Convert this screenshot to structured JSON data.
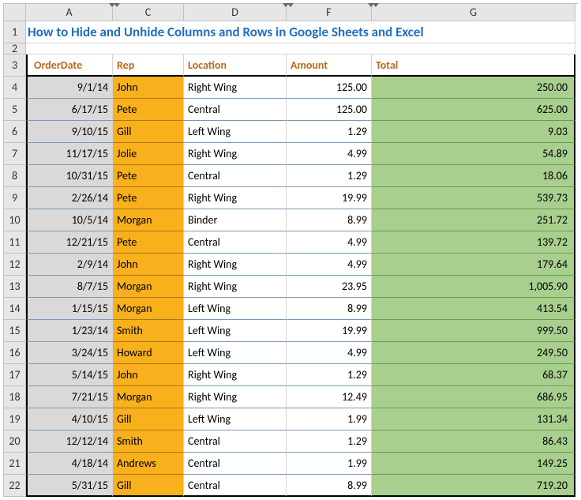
{
  "columns": [
    "A",
    "C",
    "D",
    "F",
    "G"
  ],
  "hidden_markers_after": [
    "A",
    "D",
    "F"
  ],
  "title": "How to Hide and Unhide Columns and Rows in Google Sheets and Excel",
  "headers": {
    "order_date": "OrderDate",
    "rep": "Rep",
    "location": "Location",
    "amount": "Amount",
    "total": "Total"
  },
  "rows": [
    {
      "n": 4,
      "date": "9/1/14",
      "rep": "John",
      "loc": "Right Wing",
      "amt": "125.00",
      "tot": "250.00"
    },
    {
      "n": 5,
      "date": "6/17/15",
      "rep": "Pete",
      "loc": "Central",
      "amt": "125.00",
      "tot": "625.00"
    },
    {
      "n": 6,
      "date": "9/10/15",
      "rep": "Gill",
      "loc": "Left Wing",
      "amt": "1.29",
      "tot": "9.03"
    },
    {
      "n": 7,
      "date": "11/17/15",
      "rep": "Jolie",
      "loc": "Right Wing",
      "amt": "4.99",
      "tot": "54.89"
    },
    {
      "n": 8,
      "date": "10/31/15",
      "rep": "Pete",
      "loc": "Central",
      "amt": "1.29",
      "tot": "18.06"
    },
    {
      "n": 9,
      "date": "2/26/14",
      "rep": "Pete",
      "loc": "Right Wing",
      "amt": "19.99",
      "tot": "539.73"
    },
    {
      "n": 10,
      "date": "10/5/14",
      "rep": "Morgan",
      "loc": "Binder",
      "amt": "8.99",
      "tot": "251.72"
    },
    {
      "n": 11,
      "date": "12/21/15",
      "rep": "Pete",
      "loc": "Central",
      "amt": "4.99",
      "tot": "139.72"
    },
    {
      "n": 12,
      "date": "2/9/14",
      "rep": "John",
      "loc": "Right Wing",
      "amt": "4.99",
      "tot": "179.64"
    },
    {
      "n": 13,
      "date": "8/7/15",
      "rep": "Morgan",
      "loc": "Right Wing",
      "amt": "23.95",
      "tot": "1,005.90"
    },
    {
      "n": 14,
      "date": "1/15/15",
      "rep": "Morgan",
      "loc": "Left Wing",
      "amt": "8.99",
      "tot": "413.54"
    },
    {
      "n": 15,
      "date": "1/23/14",
      "rep": "Smith",
      "loc": "Left Wing",
      "amt": "19.99",
      "tot": "999.50"
    },
    {
      "n": 16,
      "date": "3/24/15",
      "rep": "Howard",
      "loc": "Left Wing",
      "amt": "4.99",
      "tot": "249.50"
    },
    {
      "n": 17,
      "date": "5/14/15",
      "rep": "John",
      "loc": "Right Wing",
      "amt": "1.29",
      "tot": "68.37"
    },
    {
      "n": 18,
      "date": "7/21/15",
      "rep": "Morgan",
      "loc": "Right Wing",
      "amt": "12.49",
      "tot": "686.95"
    },
    {
      "n": 19,
      "date": "4/10/15",
      "rep": "Gill",
      "loc": "Left Wing",
      "amt": "1.99",
      "tot": "131.34"
    },
    {
      "n": 20,
      "date": "12/12/14",
      "rep": "Smith",
      "loc": "Central",
      "amt": "1.29",
      "tot": "86.43"
    },
    {
      "n": 21,
      "date": "4/18/14",
      "rep": "Andrews",
      "loc": "Central",
      "amt": "1.99",
      "tot": "149.25"
    },
    {
      "n": 22,
      "date": "5/31/15",
      "rep": "Gill",
      "loc": "Central",
      "amt": "8.99",
      "tot": "719.20"
    }
  ]
}
